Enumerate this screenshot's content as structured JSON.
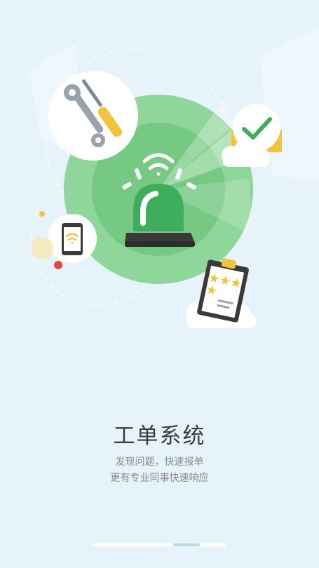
{
  "illustration": {
    "icons": [
      "wrench-icon",
      "screwdriver-icon",
      "alarm-siren-icon",
      "wifi-icon",
      "smartphone-icon",
      "checkmark-icon",
      "clipboard-icon",
      "star-icon",
      "cloud-icon"
    ],
    "colors": {
      "background": "#E6F3FB",
      "green_light": "#8FD69A",
      "green_mid": "#6CC97C",
      "green_dark": "#3FAE5C",
      "yellow": "#F2C33C",
      "red_dot": "#E2473E"
    }
  },
  "intro": {
    "title": "工单系统",
    "line1": "发现问题，快速报单",
    "line2": "更有专业同事快速响应"
  },
  "pager": {
    "total": 2,
    "current": 2
  }
}
